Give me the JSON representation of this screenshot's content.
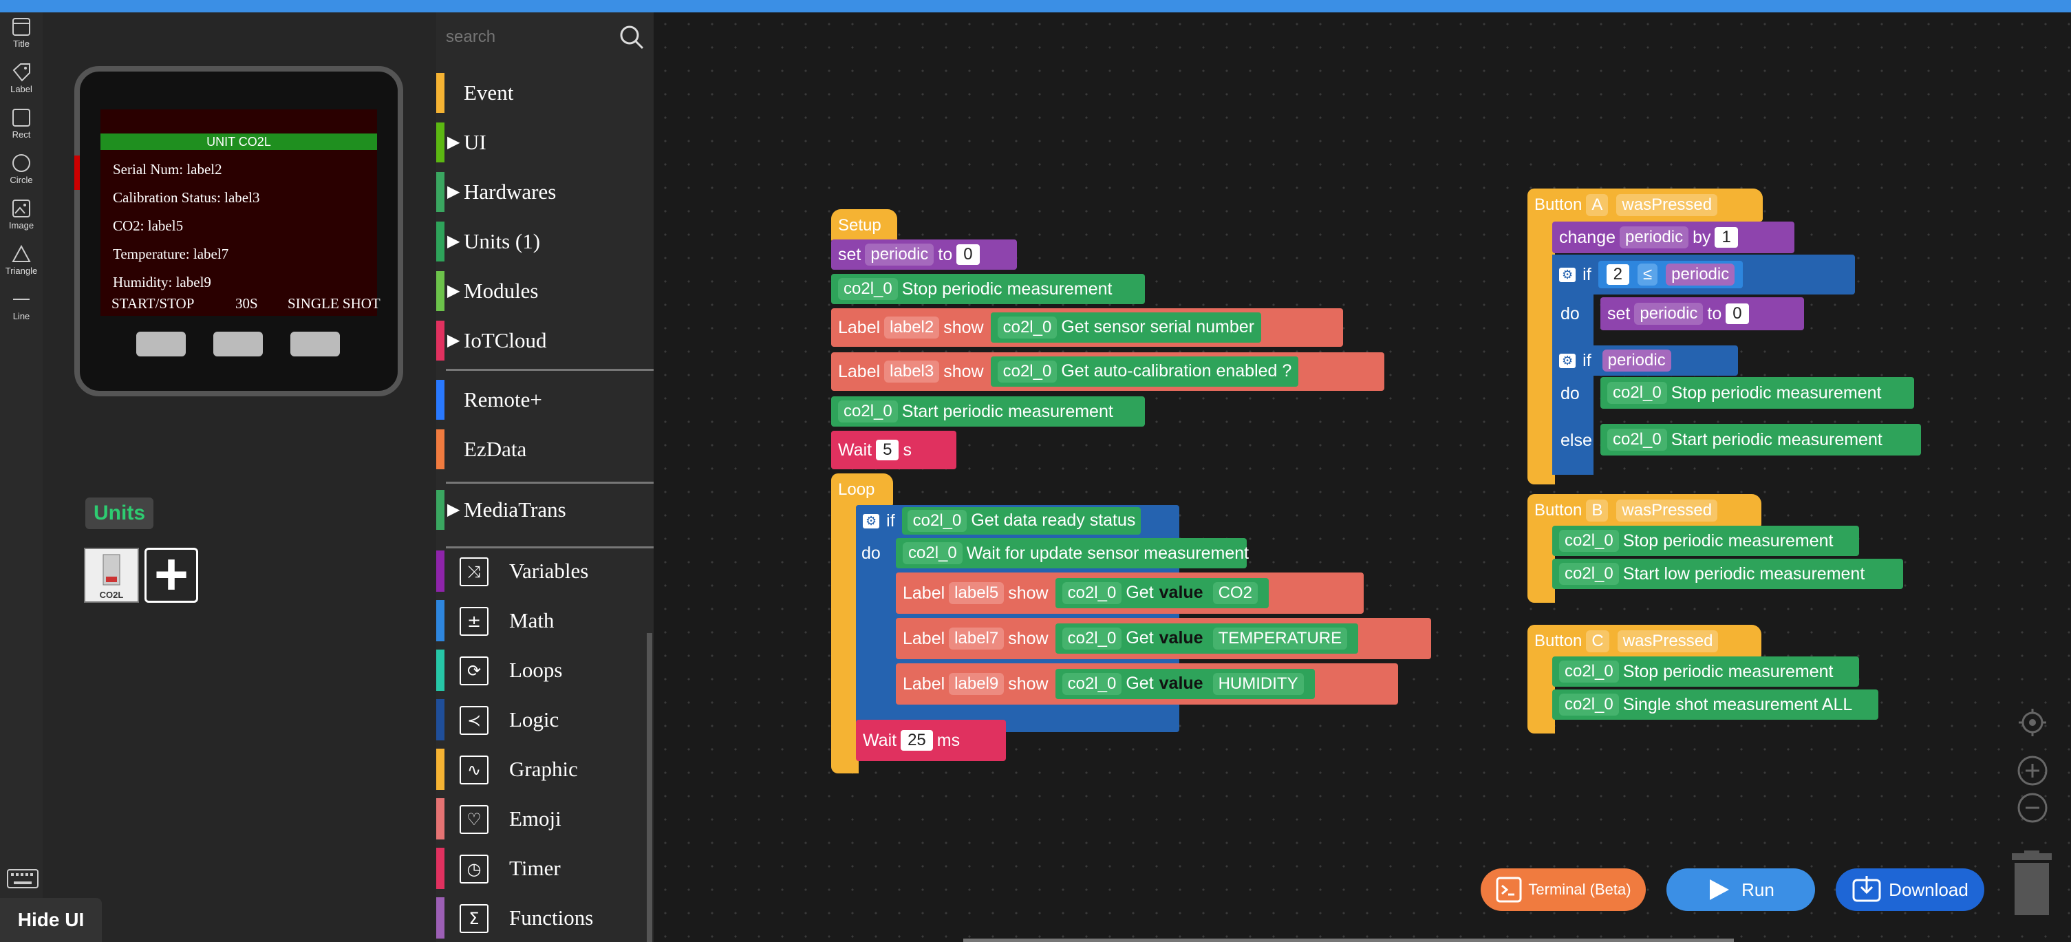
{
  "tools": [
    {
      "label": "Title",
      "icon": "title-icon"
    },
    {
      "label": "Label",
      "icon": "label-icon"
    },
    {
      "label": "Rect",
      "icon": "rect-icon"
    },
    {
      "label": "Circle",
      "icon": "circle-icon"
    },
    {
      "label": "Image",
      "icon": "image-icon"
    },
    {
      "label": "Triangle",
      "icon": "triangle-icon"
    },
    {
      "label": "Line",
      "icon": "line-icon"
    }
  ],
  "device": {
    "title": "UNIT CO2L",
    "serial": "Serial Num:  label2",
    "calibration": "Calibration Status:    label3",
    "co2": "CO2:  label5",
    "temperature": "Temperature:   label7",
    "humidity": "Humidity:  label9",
    "btnA": "START/STOP",
    "btnB": "30S",
    "btnC": "SINGLE SHOT"
  },
  "units": {
    "title": "Units",
    "thumb_label": "CO2L"
  },
  "hide_ui": "Hide UI",
  "search": {
    "placeholder": "search"
  },
  "categories": [
    {
      "label": "Event",
      "color": "#f5b333",
      "arrow": ""
    },
    {
      "label": "UI",
      "color": "#5cb712",
      "arrow": "▶"
    },
    {
      "label": "Hardwares",
      "color": "#3aa660",
      "arrow": "▶"
    },
    {
      "label": "Units (1)",
      "color": "#2ea35a",
      "arrow": "▶"
    },
    {
      "label": "Modules",
      "color": "#6cc24a",
      "arrow": "▶"
    },
    {
      "label": "IoTCloud",
      "color": "#e0315f",
      "arrow": "▶"
    },
    {
      "label": "Remote+",
      "color": "#2979ff",
      "arrow": ""
    },
    {
      "label": "EzData",
      "color": "#f07b3f",
      "arrow": ""
    },
    {
      "label": "MediaTrans",
      "color": "#3aa660",
      "arrow": "▶"
    }
  ],
  "categories2": [
    {
      "label": "Variables",
      "color": "#8e24aa",
      "icon": "⤨"
    },
    {
      "label": "Math",
      "color": "#2e86de",
      "icon": "±"
    },
    {
      "label": "Loops",
      "color": "#26c6a6",
      "icon": "⟳"
    },
    {
      "label": "Logic",
      "color": "#1f4e99",
      "icon": "≺"
    },
    {
      "label": "Graphic",
      "color": "#f5b333",
      "icon": "∿"
    },
    {
      "label": "Emoji",
      "color": "#e57373",
      "icon": "♡"
    },
    {
      "label": "Timer",
      "color": "#e0315f",
      "icon": "◷"
    },
    {
      "label": "Functions",
      "color": "#9c5fb5",
      "icon": "Σ"
    }
  ],
  "blocks": {
    "setup": "Setup",
    "set": "set",
    "var_periodic": "periodic",
    "to": "to",
    "zero": "0",
    "co2l": "co2l_0",
    "stop_periodic": "Stop periodic measurement",
    "start_periodic": "Start periodic measurement",
    "label": "Label",
    "show": "show",
    "label2": "label2",
    "label3": "label3",
    "label5": "label5",
    "label7": "label7",
    "label9": "label9",
    "get_serial": "Get sensor serial number",
    "get_autocal": "Get auto-calibration enabled ?",
    "wait": "Wait",
    "five": "5",
    "s": "s",
    "loop": "Loop",
    "if": "if",
    "do": "do",
    "else": "else",
    "get_ready": "Get data ready status",
    "wait_update": "Wait for update sensor measurement",
    "get": "Get",
    "value": "value",
    "co2": "CO2",
    "temperature": "TEMPERATURE",
    "humidity": "HUMIDITY",
    "twentyfive": "25",
    "ms": "ms",
    "button": "Button",
    "a": "A",
    "b": "B",
    "c": "C",
    "was_pressed": "wasPressed",
    "change": "change",
    "by": "by",
    "one": "1",
    "two": "2",
    "le": "≤",
    "start_low": "Start low periodic measurement",
    "single_shot": "Single shot measurement ALL"
  },
  "footer": {
    "terminal": "Terminal (Beta)",
    "run": "Run",
    "download": "Download"
  }
}
